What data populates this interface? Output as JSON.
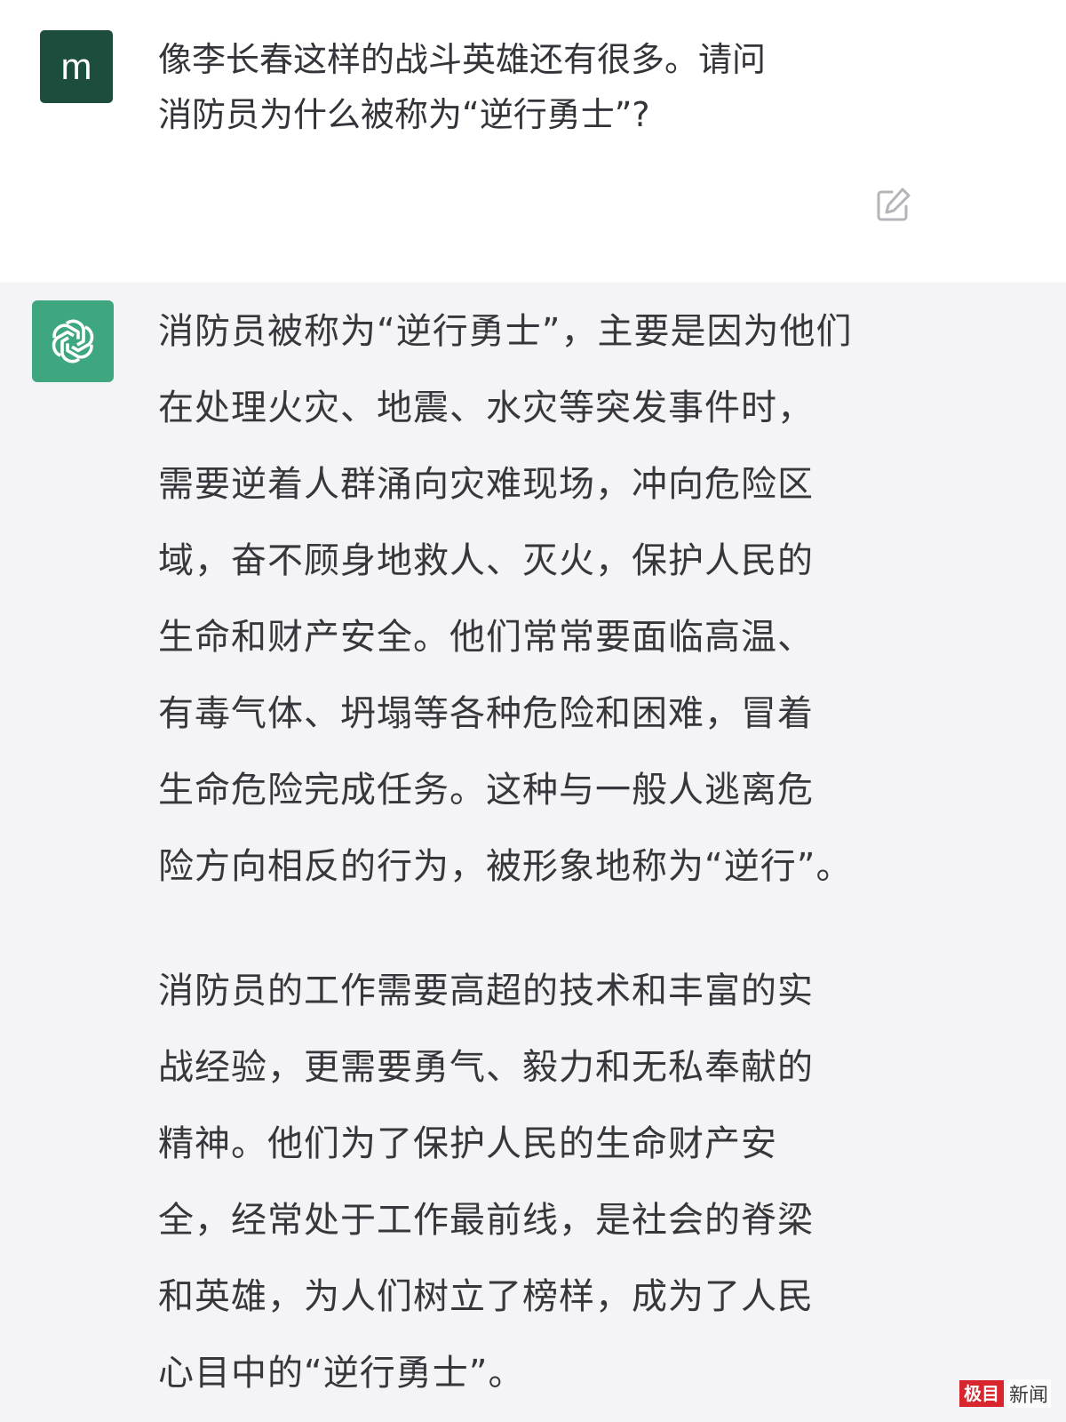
{
  "user_message": {
    "avatar_letter": "m",
    "lines": [
      "像李长春这样的战斗英雄还有很多。请问",
      "消防员为什么被称为“逆行勇士”?"
    ],
    "edit_icon": "edit-icon"
  },
  "assistant_message": {
    "avatar_icon": "openai-logo-icon",
    "paragraph1": [
      "消防员被称为“逆行勇士”，主要是因为他们",
      "在处理火灾、地震、水灾等突发事件时，",
      "需要逆着人群涌向灾难现场，冲向危险区",
      "域，奋不顾身地救人、灭火，保护人民的",
      "生命和财产安全。他们常常要面临高温、",
      "有毒气体、坍塌等各种危险和困难，冒着",
      "生命危险完成任务。这种与一般人逃离危",
      "险方向相反的行为，被形象地称为“逆行”。"
    ],
    "paragraph2": [
      "消防员的工作需要高超的技术和丰富的实",
      "战经验，更需要勇气、毅力和无私奉献的",
      "精神。他们为了保护人民的生命财产安",
      "全，经常处于工作最前线，是社会的脊梁",
      "和英雄，为人们树立了榜样，成为了人民",
      "心目中的“逆行勇士”。"
    ]
  },
  "watermark": {
    "badge": "极目",
    "text": "新闻"
  },
  "colors": {
    "user_avatar_bg": "#1d4d3c",
    "assistant_avatar_bg": "#3ea77f",
    "assistant_bg": "#f4f4f6",
    "watermark_red": "#d8262e"
  }
}
